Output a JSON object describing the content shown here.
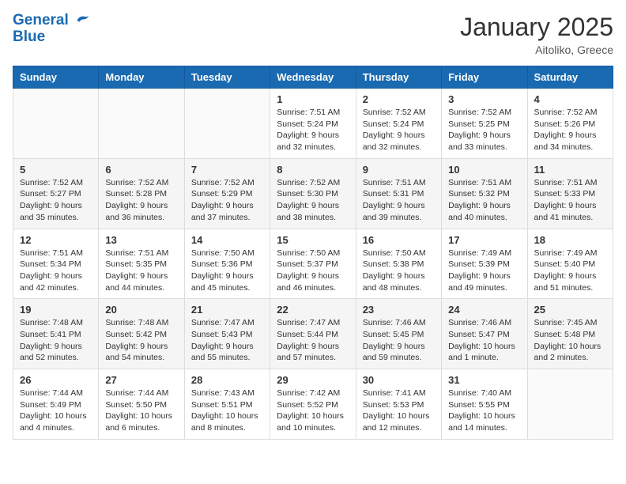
{
  "header": {
    "logo_line1": "General",
    "logo_line2": "Blue",
    "month": "January 2025",
    "location": "Aitoliko, Greece"
  },
  "weekdays": [
    "Sunday",
    "Monday",
    "Tuesday",
    "Wednesday",
    "Thursday",
    "Friday",
    "Saturday"
  ],
  "weeks": [
    [
      {
        "day": "",
        "info": ""
      },
      {
        "day": "",
        "info": ""
      },
      {
        "day": "",
        "info": ""
      },
      {
        "day": "1",
        "info": "Sunrise: 7:51 AM\nSunset: 5:24 PM\nDaylight: 9 hours and 32 minutes."
      },
      {
        "day": "2",
        "info": "Sunrise: 7:52 AM\nSunset: 5:24 PM\nDaylight: 9 hours and 32 minutes."
      },
      {
        "day": "3",
        "info": "Sunrise: 7:52 AM\nSunset: 5:25 PM\nDaylight: 9 hours and 33 minutes."
      },
      {
        "day": "4",
        "info": "Sunrise: 7:52 AM\nSunset: 5:26 PM\nDaylight: 9 hours and 34 minutes."
      }
    ],
    [
      {
        "day": "5",
        "info": "Sunrise: 7:52 AM\nSunset: 5:27 PM\nDaylight: 9 hours and 35 minutes."
      },
      {
        "day": "6",
        "info": "Sunrise: 7:52 AM\nSunset: 5:28 PM\nDaylight: 9 hours and 36 minutes."
      },
      {
        "day": "7",
        "info": "Sunrise: 7:52 AM\nSunset: 5:29 PM\nDaylight: 9 hours and 37 minutes."
      },
      {
        "day": "8",
        "info": "Sunrise: 7:52 AM\nSunset: 5:30 PM\nDaylight: 9 hours and 38 minutes."
      },
      {
        "day": "9",
        "info": "Sunrise: 7:51 AM\nSunset: 5:31 PM\nDaylight: 9 hours and 39 minutes."
      },
      {
        "day": "10",
        "info": "Sunrise: 7:51 AM\nSunset: 5:32 PM\nDaylight: 9 hours and 40 minutes."
      },
      {
        "day": "11",
        "info": "Sunrise: 7:51 AM\nSunset: 5:33 PM\nDaylight: 9 hours and 41 minutes."
      }
    ],
    [
      {
        "day": "12",
        "info": "Sunrise: 7:51 AM\nSunset: 5:34 PM\nDaylight: 9 hours and 42 minutes."
      },
      {
        "day": "13",
        "info": "Sunrise: 7:51 AM\nSunset: 5:35 PM\nDaylight: 9 hours and 44 minutes."
      },
      {
        "day": "14",
        "info": "Sunrise: 7:50 AM\nSunset: 5:36 PM\nDaylight: 9 hours and 45 minutes."
      },
      {
        "day": "15",
        "info": "Sunrise: 7:50 AM\nSunset: 5:37 PM\nDaylight: 9 hours and 46 minutes."
      },
      {
        "day": "16",
        "info": "Sunrise: 7:50 AM\nSunset: 5:38 PM\nDaylight: 9 hours and 48 minutes."
      },
      {
        "day": "17",
        "info": "Sunrise: 7:49 AM\nSunset: 5:39 PM\nDaylight: 9 hours and 49 minutes."
      },
      {
        "day": "18",
        "info": "Sunrise: 7:49 AM\nSunset: 5:40 PM\nDaylight: 9 hours and 51 minutes."
      }
    ],
    [
      {
        "day": "19",
        "info": "Sunrise: 7:48 AM\nSunset: 5:41 PM\nDaylight: 9 hours and 52 minutes."
      },
      {
        "day": "20",
        "info": "Sunrise: 7:48 AM\nSunset: 5:42 PM\nDaylight: 9 hours and 54 minutes."
      },
      {
        "day": "21",
        "info": "Sunrise: 7:47 AM\nSunset: 5:43 PM\nDaylight: 9 hours and 55 minutes."
      },
      {
        "day": "22",
        "info": "Sunrise: 7:47 AM\nSunset: 5:44 PM\nDaylight: 9 hours and 57 minutes."
      },
      {
        "day": "23",
        "info": "Sunrise: 7:46 AM\nSunset: 5:45 PM\nDaylight: 9 hours and 59 minutes."
      },
      {
        "day": "24",
        "info": "Sunrise: 7:46 AM\nSunset: 5:47 PM\nDaylight: 10 hours and 1 minute."
      },
      {
        "day": "25",
        "info": "Sunrise: 7:45 AM\nSunset: 5:48 PM\nDaylight: 10 hours and 2 minutes."
      }
    ],
    [
      {
        "day": "26",
        "info": "Sunrise: 7:44 AM\nSunset: 5:49 PM\nDaylight: 10 hours and 4 minutes."
      },
      {
        "day": "27",
        "info": "Sunrise: 7:44 AM\nSunset: 5:50 PM\nDaylight: 10 hours and 6 minutes."
      },
      {
        "day": "28",
        "info": "Sunrise: 7:43 AM\nSunset: 5:51 PM\nDaylight: 10 hours and 8 minutes."
      },
      {
        "day": "29",
        "info": "Sunrise: 7:42 AM\nSunset: 5:52 PM\nDaylight: 10 hours and 10 minutes."
      },
      {
        "day": "30",
        "info": "Sunrise: 7:41 AM\nSunset: 5:53 PM\nDaylight: 10 hours and 12 minutes."
      },
      {
        "day": "31",
        "info": "Sunrise: 7:40 AM\nSunset: 5:55 PM\nDaylight: 10 hours and 14 minutes."
      },
      {
        "day": "",
        "info": ""
      }
    ]
  ]
}
